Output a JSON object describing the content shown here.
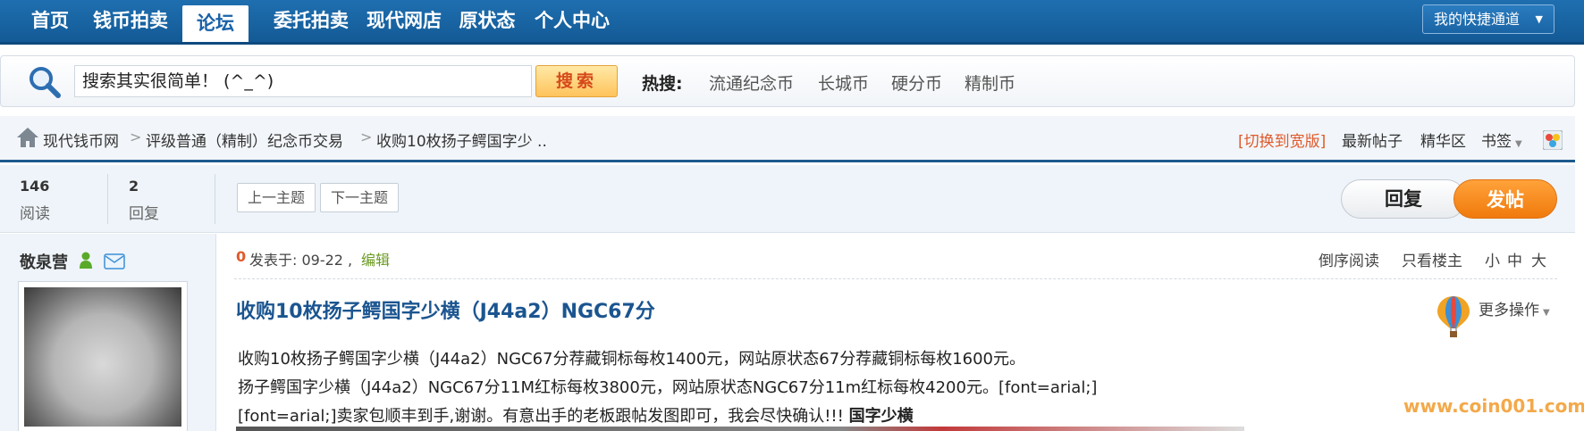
{
  "nav": {
    "items": [
      "首页",
      "钱币拍卖",
      "论坛",
      "委托拍卖",
      "现代网店",
      "原状态",
      "个人中心"
    ],
    "active": "论坛",
    "quick_link": "我的快捷通道"
  },
  "search": {
    "value": "搜索其实很简单！ (^_^)",
    "button": "搜索",
    "hot_label": "热搜:",
    "hot_links": [
      "流通纪念币",
      "长城币",
      "硬分币",
      "精制币"
    ]
  },
  "breadcrumb": {
    "items": [
      "现代钱币网",
      "评级普通（精制）纪念币交易",
      "收购10枚扬子鳄国字少 .."
    ]
  },
  "toolbar": {
    "switch_wide": "[切换到宽版]",
    "latest_posts": "最新帖子",
    "digest": "精华区",
    "bookmarks": "书签"
  },
  "stats": {
    "views": "146",
    "views_label": "阅读",
    "replies": "2",
    "replies_label": "回复"
  },
  "pager": {
    "prev": "上一主题",
    "next": "下一主题"
  },
  "actions": {
    "reply": "回复",
    "new_post": "发帖"
  },
  "author": {
    "name": "敬泉营"
  },
  "post": {
    "floor_count": "0",
    "posted_at": "发表于: 09-22 ,",
    "edit": "编辑",
    "tools": [
      "倒序阅读",
      "只看楼主",
      "小",
      "中",
      "大"
    ],
    "title": "收购10枚扬子鳄国字少横（J44a2）NGC67分",
    "more_ops": "更多操作",
    "lines": [
      "收购10枚扬子鳄国字少横（J44a2）NGC67分荐藏铜标每枚1400元，网站原状态67分荐藏铜标每枚1600元。",
      "扬子鳄国字少横（J44a2）NGC67分11M红标每枚3800元，网站原状态NGC67分11m红标每枚4200元。[font=arial;]",
      "[font=arial;]卖家包顺丰到手,谢谢。有意出手的老板跟帖发图即可，我会尽快确认!!!"
    ],
    "tag": "国字少横"
  },
  "watermark": "www.coin001.com",
  "colors": {
    "nav_bg": "#1a65a6",
    "link_blue": "#1b5590",
    "post_orange": "#f07a0c",
    "switch_red": "#e05a2b",
    "watermark": "#f3a94a"
  }
}
